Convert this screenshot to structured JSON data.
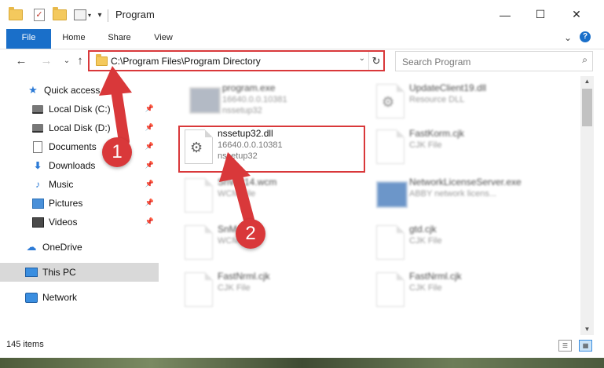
{
  "window": {
    "title": "Program",
    "minimize_glyph": "—",
    "maximize_glyph": "☐",
    "close_glyph": "✕"
  },
  "ribbon": {
    "tabs": [
      "File",
      "Home",
      "Share",
      "View"
    ],
    "expand_glyph": "⌄",
    "help_glyph": "?"
  },
  "nav": {
    "back": "←",
    "forward": "→",
    "recent": "⌄",
    "up": "↑"
  },
  "address": {
    "path": "C:\\Program Files\\Program Directory",
    "dropdown_glyph": "⌄",
    "refresh_glyph": "↻"
  },
  "search": {
    "placeholder": "Search Program",
    "icon_glyph": "⌕"
  },
  "sidebar": {
    "items": [
      {
        "label": "Quick access",
        "icon": "star-icon",
        "pinned": false
      },
      {
        "label": "Local Disk (C:)",
        "icon": "drive-icon",
        "pinned": true
      },
      {
        "label": "Local Disk (D:)",
        "icon": "drive-icon",
        "pinned": true
      },
      {
        "label": "Documents",
        "icon": "documents-icon",
        "pinned": true
      },
      {
        "label": "Downloads",
        "icon": "downloads-icon",
        "pinned": true
      },
      {
        "label": "Music",
        "icon": "music-icon",
        "pinned": true
      },
      {
        "label": "Pictures",
        "icon": "pictures-icon",
        "pinned": true
      },
      {
        "label": "Videos",
        "icon": "videos-icon",
        "pinned": true
      },
      {
        "label": "OneDrive",
        "icon": "onedrive-icon",
        "pinned": false
      },
      {
        "label": "This PC",
        "icon": "this-pc-icon",
        "pinned": false,
        "selected": true
      },
      {
        "label": "Network",
        "icon": "network-icon",
        "pinned": false
      }
    ]
  },
  "files": [
    {
      "name": "program.exe",
      "line2": "16640.0.0.10381",
      "line3": "nssetup32",
      "blurred": true
    },
    {
      "name": "UpdateClient19.dll",
      "line2": "Resource DLL",
      "line3": "",
      "blurred": true
    },
    {
      "name": "nssetup32.dll",
      "line2": "16640.0.0.10381",
      "line3": "nssetup32",
      "blurred": false,
      "highlighted": true
    },
    {
      "name": "FastKorm.cjk",
      "line2": "CJK File",
      "line3": "",
      "blurred": true
    },
    {
      "name": "SnWP14.wcm",
      "line2": "WCM File",
      "line3": "",
      "blurred": true
    },
    {
      "name": "NetworkLicenseServer.exe",
      "line2": "ABBY network licens...",
      "line3": "",
      "blurred": true
    },
    {
      "name": "SnM...wcm",
      "line2": "WCM File",
      "line3": "",
      "blurred": true
    },
    {
      "name": "gtd.cjk",
      "line2": "CJK File",
      "line3": "",
      "blurred": true
    },
    {
      "name": "FastNrml.cjk",
      "line2": "CJK File",
      "line3": "",
      "blurred": true
    },
    {
      "name": "FastNrml.cjk",
      "line2": "CJK File",
      "line3": "",
      "blurred": true
    }
  ],
  "status": {
    "item_count": "145 items"
  },
  "annotations": {
    "step1": "1",
    "step2": "2",
    "color": "#d9383a"
  }
}
